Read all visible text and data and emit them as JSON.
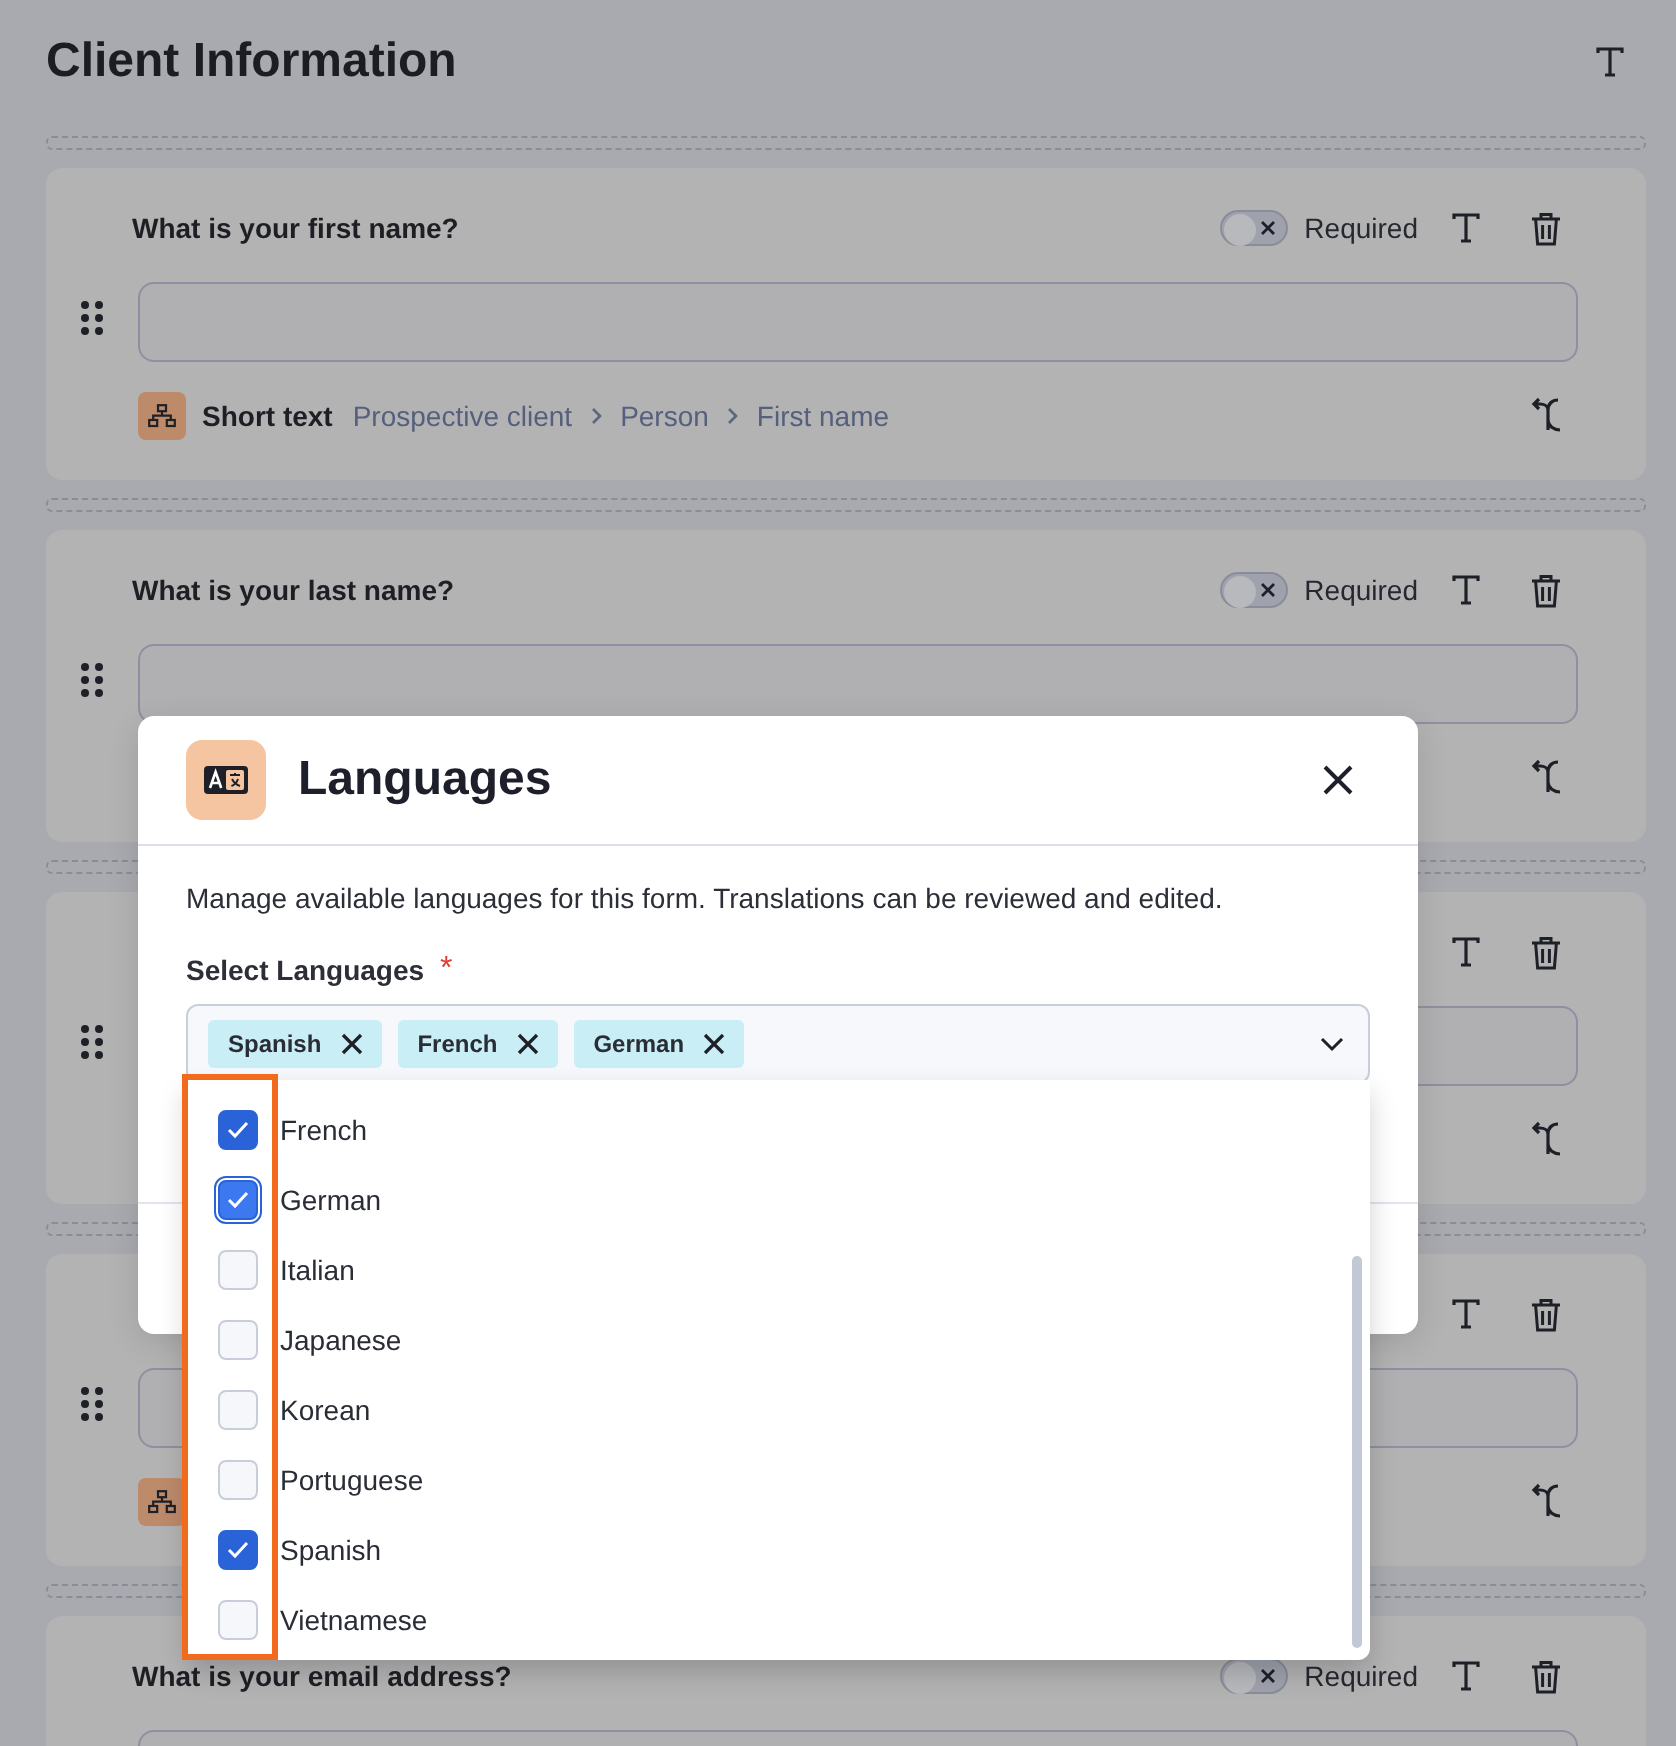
{
  "page": {
    "title": "Client Information"
  },
  "cards": [
    {
      "kind": "short_text",
      "question": "What is your first name?",
      "required": false,
      "required_label": "Required",
      "type_label": "Short text",
      "breadcrumb": [
        "Prospective client",
        "Person",
        "First name"
      ]
    },
    {
      "kind": "question",
      "question": "What is your last name?",
      "required": false,
      "required_label": "Required"
    },
    {
      "kind": "question"
    },
    {
      "kind": "short_text"
    },
    {
      "kind": "header_only",
      "question": "What is your email address?",
      "required": false,
      "required_label": "Required"
    }
  ],
  "modal": {
    "title": "Languages",
    "description": "Manage available languages for this form. Translations can be reviewed and edited.",
    "field_label": "Select Languages",
    "required_mark": "*",
    "chips": [
      "Spanish",
      "French",
      "German"
    ]
  },
  "dropdown": {
    "options": [
      {
        "label": "French",
        "checked": true,
        "focused": false
      },
      {
        "label": "German",
        "checked": true,
        "focused": true
      },
      {
        "label": "Italian",
        "checked": false,
        "focused": false
      },
      {
        "label": "Japanese",
        "checked": false,
        "focused": false
      },
      {
        "label": "Korean",
        "checked": false,
        "focused": false
      },
      {
        "label": "Portuguese",
        "checked": false,
        "focused": false
      },
      {
        "label": "Spanish",
        "checked": true,
        "focused": false
      },
      {
        "label": "Vietnamese",
        "checked": false,
        "focused": false
      }
    ]
  }
}
